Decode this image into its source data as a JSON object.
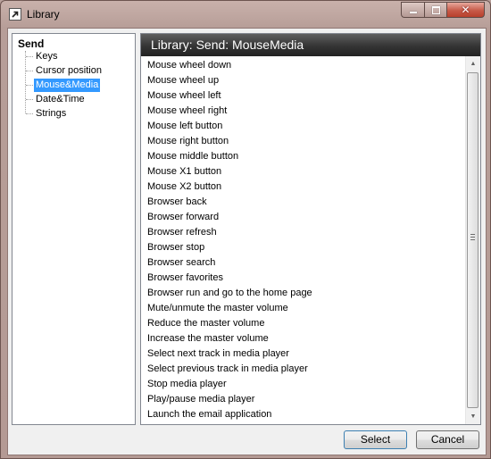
{
  "window": {
    "title": "Library",
    "icon": "shortcut-arrow-icon",
    "close_glyph": "✕"
  },
  "tree": {
    "root": "Send",
    "items": [
      "Keys",
      "Cursor position",
      "Mouse&Media",
      "Date&Time",
      "Strings"
    ],
    "selected": "Mouse&Media"
  },
  "panel": {
    "header": "Library:  Send:  MouseMedia",
    "items": [
      "Mouse wheel down",
      "Mouse wheel up",
      "Mouse wheel left",
      "Mouse wheel right",
      "Mouse left button",
      "Mouse right button",
      "Mouse middle button",
      "Mouse X1 button",
      "Mouse X2 button",
      "Browser back",
      "Browser forward",
      "Browser refresh",
      "Browser stop",
      "Browser search",
      "Browser favorites",
      "Browser run and go to the home page",
      "Mute/unmute the master volume",
      "Reduce the master volume",
      "Increase the master volume",
      "Select next track in media player",
      "Select previous track in media player",
      "Stop media player",
      "Play/pause media player",
      "Launch the email application"
    ]
  },
  "buttons": {
    "select": "Select",
    "cancel": "Cancel"
  },
  "scrollbar": {
    "up_glyph": "▲",
    "down_glyph": "▼"
  },
  "colors": {
    "selection": "#3399ff",
    "header_bg": "#2f2f2f",
    "close_button": "#c75a48"
  }
}
